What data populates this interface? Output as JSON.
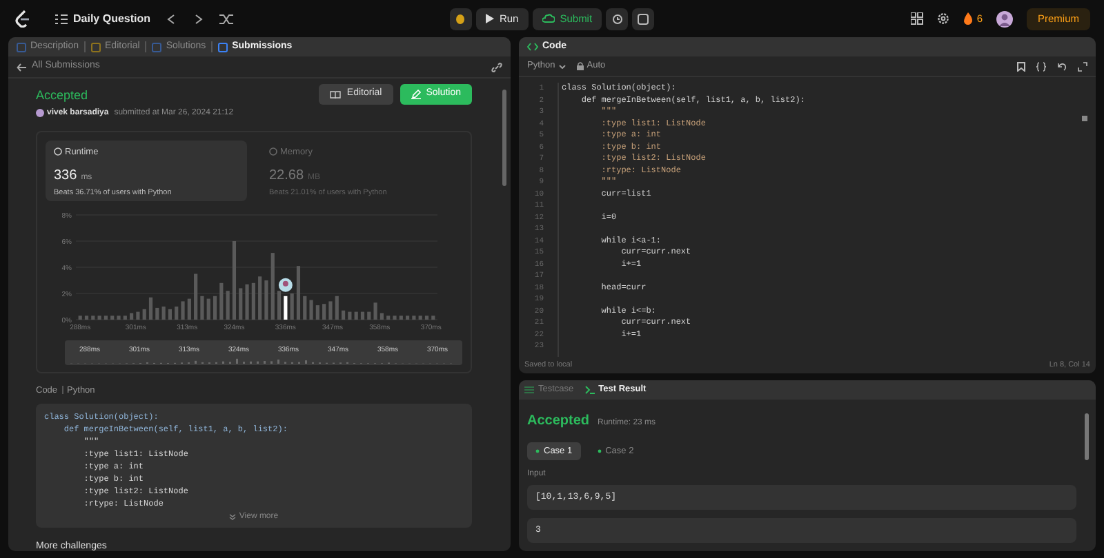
{
  "top_bar": {
    "problem_list": "Daily Question",
    "run": "Run",
    "submit": "Submit",
    "streak": "6",
    "premium": "Premium"
  },
  "left_panel": {
    "tabs": [
      {
        "label": "Description",
        "selected": false
      },
      {
        "label": "Editorial",
        "selected": false
      },
      {
        "label": "Solutions",
        "selected": false
      },
      {
        "label": "Submissions",
        "selected": true
      }
    ],
    "back_link": "All Submissions",
    "status": "Accepted",
    "user": "vivek barsadiya",
    "submitted": "submitted at Mar 26, 2024 21:12",
    "buttons": [
      {
        "label": "Editorial",
        "kind": "secondary"
      },
      {
        "label": "Solution",
        "kind": "primary"
      }
    ],
    "metrics": [
      {
        "label": "Runtime",
        "value": "336",
        "unit": "ms",
        "beats": "Beats 36.71% of users with Python",
        "selected": true
      },
      {
        "label": "Memory",
        "value": "22.68",
        "unit": "MB",
        "beats": "Beats 21.01% of users with Python",
        "selected": false
      }
    ],
    "chart_data": {
      "type": "bar",
      "x": [
        288,
        289.5,
        291,
        292.5,
        294,
        295.5,
        297,
        298.5,
        300,
        301.5,
        303,
        304.5,
        306,
        307.5,
        309,
        310.5,
        312,
        313.5,
        315,
        316.5,
        318,
        319.5,
        321,
        322.5,
        324,
        325.5,
        327,
        328.5,
        330,
        331.5,
        333,
        334.5,
        336,
        337.5,
        339,
        340.5,
        342,
        343.5,
        345,
        346.5,
        348,
        349.5,
        351,
        352.5,
        354,
        355.5,
        357,
        358.5,
        360,
        361.5,
        363,
        364.5,
        366,
        367.5,
        369,
        370.5
      ],
      "series": [
        {
          "color": "#5a5a5a",
          "values": [
            0.3,
            0.3,
            0.3,
            0.3,
            0.3,
            0.3,
            0.3,
            0.3,
            0.5,
            0.6,
            0.8,
            1.7,
            0.9,
            1.0,
            0.8,
            1.0,
            1.4,
            1.6,
            3.5,
            1.8,
            1.6,
            1.8,
            2.8,
            2.2,
            6.0,
            2.4,
            2.7,
            2.8,
            3.3,
            3.0,
            5.1,
            2.2,
            null,
            2.0,
            4.1,
            1.8,
            1.5,
            1.1,
            1.2,
            1.4,
            1.8,
            0.7,
            0.6,
            0.6,
            0.6,
            0.6,
            1.3,
            0.5,
            0.3,
            0.3,
            0.3,
            0.3,
            0.3,
            0.3,
            0.3,
            0.3
          ]
        },
        {
          "color": "#ffffff",
          "values": [
            null,
            null,
            null,
            null,
            null,
            null,
            null,
            null,
            null,
            null,
            null,
            null,
            null,
            null,
            null,
            null,
            null,
            null,
            null,
            null,
            null,
            null,
            null,
            null,
            null,
            null,
            null,
            null,
            null,
            null,
            null,
            null,
            1.8,
            null,
            null,
            null,
            null,
            null,
            null,
            null,
            null,
            null,
            null,
            null,
            null,
            null,
            null,
            null,
            null,
            null,
            null,
            null,
            null,
            null,
            null,
            null
          ]
        }
      ],
      "grid": true,
      "xlim": [
        287,
        371.5
      ],
      "ylim": [
        0,
        8
      ],
      "yticks": [
        {
          "value": 0,
          "label": "0%"
        },
        {
          "value": 2,
          "label": "2%"
        },
        {
          "value": 4,
          "label": "4%"
        },
        {
          "value": 6,
          "label": "6%"
        },
        {
          "value": 8,
          "label": "8%"
        }
      ],
      "xticks": [
        {
          "value": 288,
          "label": "288ms"
        },
        {
          "value": 301,
          "label": "301ms"
        },
        {
          "value": 313,
          "label": "313ms"
        },
        {
          "value": 324,
          "label": "324ms"
        },
        {
          "value": 336,
          "label": "336ms"
        },
        {
          "value": 347,
          "label": "347ms"
        },
        {
          "value": 358,
          "label": "358ms"
        },
        {
          "value": 370,
          "label": "370ms"
        }
      ]
    },
    "range_labels": [
      "288ms",
      "301ms",
      "313ms",
      "324ms",
      "336ms",
      "347ms",
      "358ms",
      "370ms"
    ],
    "code_title": "Code",
    "code_language": "Python",
    "code_lines": [
      {
        "text": "class Solution(object):",
        "kind": "code"
      },
      {
        "text": "    def mergeInBetween(self, list1, a, b, list2):",
        "kind": "code"
      },
      {
        "text": "        \"\"\"",
        "kind": "docstring"
      },
      {
        "text": "        :type list1: ListNode",
        "kind": "docstring"
      },
      {
        "text": "        :type a: int",
        "kind": "docstring"
      },
      {
        "text": "        :type b: int",
        "kind": "docstring"
      },
      {
        "text": "        :type list2: ListNode",
        "kind": "docstring"
      },
      {
        "text": "        :rtype: ListNode",
        "kind": "docstring"
      }
    ],
    "view_more": "View more",
    "more_challenges": "More challenges"
  },
  "editor": {
    "tab": "Code",
    "language": "Python",
    "mode": "Auto",
    "lines": [
      {
        "n": "1",
        "text": "class Solution(object):",
        "kind": "code"
      },
      {
        "n": "2",
        "text": "    def mergeInBetween(self, list1, a, b, list2):",
        "kind": "code"
      },
      {
        "n": "3",
        "text": "        \"\"\"",
        "kind": "docstring"
      },
      {
        "n": "4",
        "text": "        :type list1: ListNode",
        "kind": "docstring"
      },
      {
        "n": "5",
        "text": "        :type a: int",
        "kind": "docstring"
      },
      {
        "n": "6",
        "text": "        :type b: int",
        "kind": "docstring"
      },
      {
        "n": "7",
        "text": "        :type list2: ListNode",
        "kind": "docstring"
      },
      {
        "n": "8",
        "text": "        :rtype: ListNode",
        "kind": "docstring"
      },
      {
        "n": "9",
        "text": "        \"\"\"",
        "kind": "docstring"
      },
      {
        "n": "10",
        "text": "        curr=list1",
        "kind": "code"
      },
      {
        "n": "11",
        "kind": "code"
      },
      {
        "n": "12",
        "text": "        i=0",
        "kind": "code"
      },
      {
        "n": "13",
        "kind": "code"
      },
      {
        "n": "14",
        "text": "        while i<a-1:",
        "kind": "code"
      },
      {
        "n": "15",
        "text": "            curr=curr.next",
        "kind": "code"
      },
      {
        "n": "16",
        "text": "            i+=1",
        "kind": "code"
      },
      {
        "n": "17",
        "kind": "code"
      },
      {
        "n": "18",
        "text": "        head=curr",
        "kind": "code"
      },
      {
        "n": "19",
        "kind": "code"
      },
      {
        "n": "20",
        "text": "        while i<=b:",
        "kind": "code"
      },
      {
        "n": "21",
        "text": "            curr=curr.next",
        "kind": "code"
      },
      {
        "n": "22",
        "text": "            i+=1",
        "kind": "code"
      },
      {
        "n": "23",
        "kind": "code"
      }
    ],
    "saved": "Saved to local",
    "cursor": "Ln 8, Col 14"
  },
  "test_panel": {
    "tabs": [
      {
        "label": "Testcase",
        "selected": false
      },
      {
        "label": "Test Result",
        "selected": true
      }
    ],
    "status": "Accepted",
    "runtime": "Runtime: 23 ms",
    "cases": [
      {
        "label": "Case 1",
        "selected": true
      },
      {
        "label": "Case 2",
        "selected": false
      }
    ],
    "input_label": "Input",
    "fields": [
      "[10,1,13,6,9,5]",
      "3"
    ]
  }
}
